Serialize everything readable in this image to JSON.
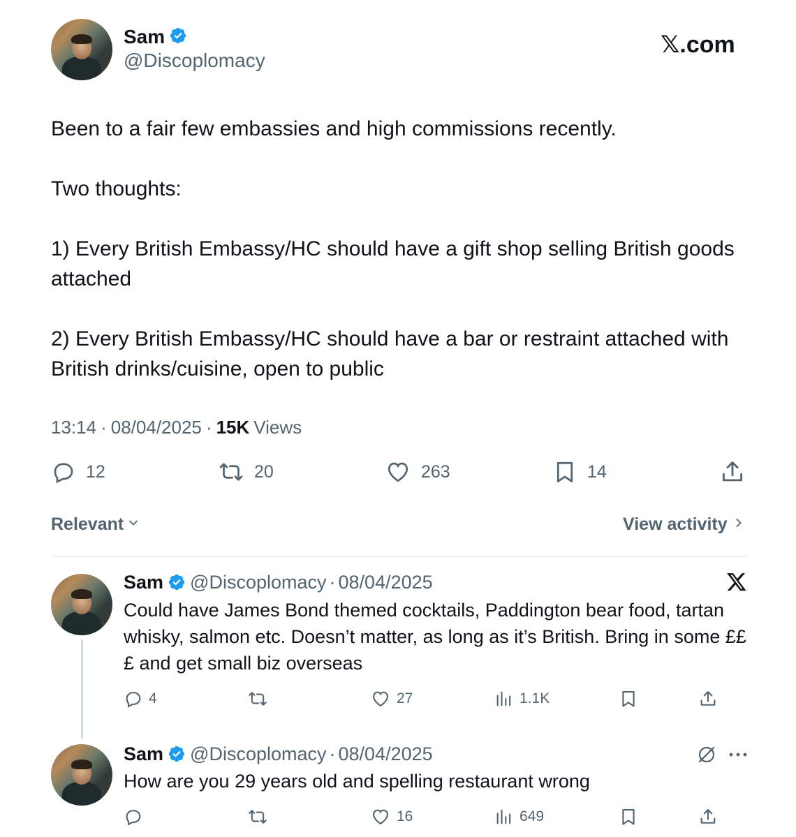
{
  "main_tweet": {
    "author_name": "Sam",
    "author_handle": "@Discoplomacy",
    "brand": "𝕏.com",
    "body": "Been to a fair few embassies and high commissions recently.\n\nTwo thoughts:\n\n1) Every British Embassy/HC should have a gift shop selling British goods attached\n\n2) Every British Embassy/HC should have a bar or restraint attached with British drinks/cuisine, open to public",
    "time": "13:14",
    "date": "08/04/2025",
    "views_count": "15K",
    "views_label": "Views",
    "meta_sep": "·",
    "actions": {
      "replies": "12",
      "reposts": "20",
      "likes": "263",
      "bookmarks": "14"
    }
  },
  "sort": {
    "label": "Relevant",
    "view_activity": "View activity"
  },
  "replies": [
    {
      "author_name": "Sam",
      "author_handle": "@Discoplomacy",
      "sep": "·",
      "date": "08/04/2025",
      "body": "Could have James Bond themed cocktails, Paddington bear food, tartan whisky, salmon etc. Doesn’t matter, as long as it’s British. Bring in some £££ and get small biz overseas",
      "actions": {
        "replies": "4",
        "reposts": "",
        "likes": "27",
        "views": "1.1K"
      }
    },
    {
      "author_name": "Sam",
      "author_handle": "@Discoplomacy",
      "sep": "·",
      "date": "08/04/2025",
      "body": "How are you 29 years old and spelling restaurant wrong",
      "actions": {
        "replies": "",
        "reposts": "",
        "likes": "16",
        "views": "649"
      }
    }
  ],
  "colors": {
    "verified": "#1d9bf0",
    "muted": "#536471",
    "text": "#0f1419"
  }
}
